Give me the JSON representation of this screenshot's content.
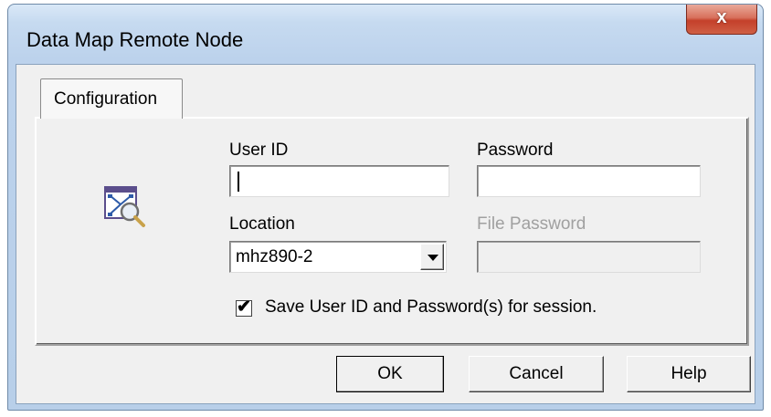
{
  "window": {
    "title": "Data Map Remote Node",
    "close_glyph": "x"
  },
  "tabs": [
    {
      "label": "Configuration",
      "active": true
    }
  ],
  "form": {
    "user_id": {
      "label": "User ID",
      "value": ""
    },
    "password": {
      "label": "Password",
      "value": ""
    },
    "location": {
      "label": "Location",
      "value": "mhz890-2"
    },
    "file_password": {
      "label": "File Password",
      "value": "",
      "disabled": true
    },
    "save_checkbox": {
      "label": "Save User ID and Password(s) for session.",
      "checked": true,
      "check_glyph": "✔"
    }
  },
  "buttons": {
    "ok": "OK",
    "cancel": "Cancel",
    "help": "Help"
  },
  "icons": {
    "app": "data-map-search-icon",
    "dropdown": "chevron-down-icon"
  },
  "colors": {
    "close_button": "#c4402a",
    "frame": "#bcd2ec",
    "dialog_bg": "#f0f0f0"
  }
}
